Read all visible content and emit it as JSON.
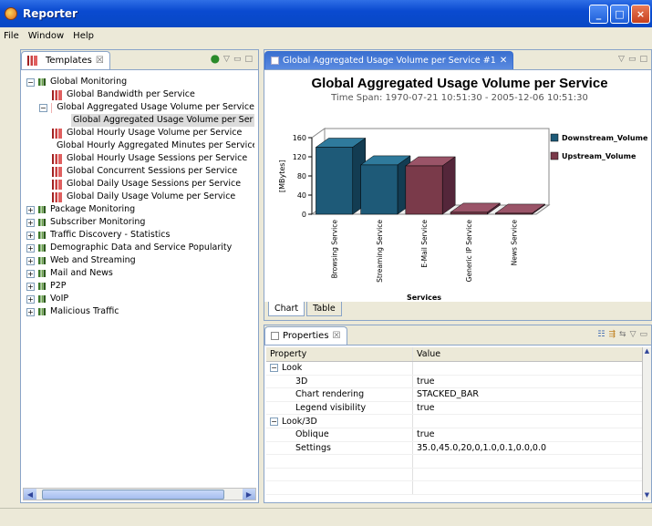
{
  "window": {
    "title": "Reporter"
  },
  "menu": [
    "File",
    "Window",
    "Help"
  ],
  "templates": {
    "tab_label": "Templates",
    "tree": [
      {
        "label": "Global Monitoring",
        "type": "group",
        "level": 0,
        "exp": "−"
      },
      {
        "label": "Global Bandwidth per Service",
        "type": "report",
        "level": 1
      },
      {
        "label": "Global Aggregated Usage Volume per Service",
        "type": "report",
        "level": 1,
        "exp": "−"
      },
      {
        "label": "Global Aggregated Usage Volume per Ser",
        "type": "report-selected",
        "level": 2
      },
      {
        "label": "Global Hourly Usage Volume per Service",
        "type": "report",
        "level": 1
      },
      {
        "label": "Global Hourly Aggregated Minutes per Service",
        "type": "report",
        "level": 1
      },
      {
        "label": "Global Hourly Usage Sessions per Service",
        "type": "report",
        "level": 1
      },
      {
        "label": "Global Concurrent Sessions per Service",
        "type": "report",
        "level": 1
      },
      {
        "label": "Global Daily Usage Sessions per Service",
        "type": "report",
        "level": 1
      },
      {
        "label": "Global Daily Usage Volume per Service",
        "type": "report",
        "level": 1
      },
      {
        "label": "Package Monitoring",
        "type": "group",
        "level": 0,
        "exp": "+"
      },
      {
        "label": "Subscriber Monitoring",
        "type": "group",
        "level": 0,
        "exp": "+"
      },
      {
        "label": "Traffic Discovery - Statistics",
        "type": "group",
        "level": 0,
        "exp": "+"
      },
      {
        "label": "Demographic Data and Service Popularity",
        "type": "group",
        "level": 0,
        "exp": "+"
      },
      {
        "label": "Web and Streaming",
        "type": "group",
        "level": 0,
        "exp": "+"
      },
      {
        "label": "Mail and News",
        "type": "group",
        "level": 0,
        "exp": "+"
      },
      {
        "label": "P2P",
        "type": "group",
        "level": 0,
        "exp": "+"
      },
      {
        "label": "VoIP",
        "type": "group",
        "level": 0,
        "exp": "+"
      },
      {
        "label": "Malicious Traffic",
        "type": "group",
        "level": 0,
        "exp": "+"
      }
    ]
  },
  "editor": {
    "tab_label": "Global Aggregated Usage Volume per Service #1",
    "bottom_tabs": [
      "Chart",
      "Table"
    ]
  },
  "chart_data": {
    "type": "bar",
    "title": "Global Aggregated Usage Volume per Service",
    "subtitle": "Time Span: 1970-07-21 10:51:30 - 2005-12-06 10:51:30",
    "xlabel": "Services",
    "ylabel": "[MBytes]",
    "ylim": [
      0,
      160
    ],
    "yticks": [
      0,
      40,
      80,
      120,
      160
    ],
    "categories": [
      "Browsing Service",
      "Streaming Service",
      "E-Mail Service",
      "Generic IP Service",
      "News Service"
    ],
    "series": [
      {
        "name": "Downstream_Volume",
        "values": [
          140,
          103,
          0,
          0,
          0
        ],
        "color": "#1e5a78"
      },
      {
        "name": "Upstream_Volume",
        "values": [
          0,
          0,
          101,
          4,
          2
        ],
        "color": "#7a3a4a"
      }
    ],
    "legend": "right"
  },
  "properties": {
    "tab_label": "Properties",
    "headers": [
      "Property",
      "Value"
    ],
    "rows": [
      {
        "name": "Look",
        "value": "",
        "cat": true
      },
      {
        "name": "3D",
        "value": "true"
      },
      {
        "name": "Chart rendering",
        "value": "STACKED_BAR"
      },
      {
        "name": "Legend visibility",
        "value": "true"
      },
      {
        "name": "Look/3D",
        "value": "",
        "cat": true
      },
      {
        "name": "Oblique",
        "value": "true"
      },
      {
        "name": "Settings",
        "value": "35.0,45.0,20,0,1.0,0.1,0.0,0.0"
      }
    ]
  }
}
